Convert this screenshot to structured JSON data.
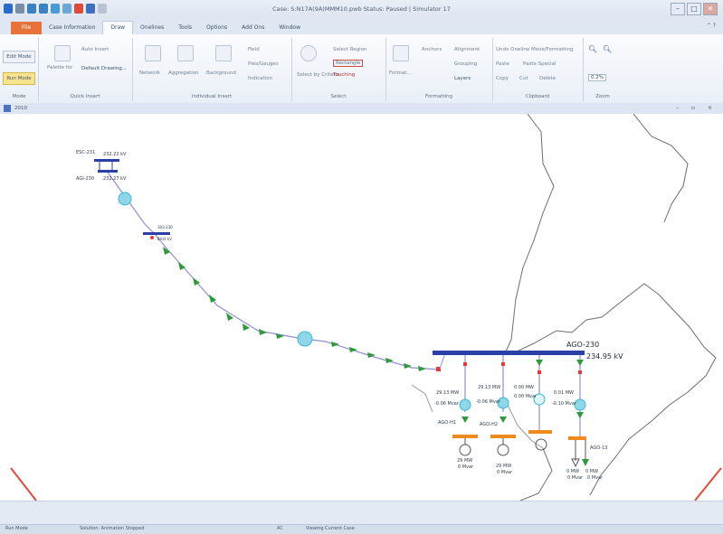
{
  "window": {
    "title": "Case: S:N17A(9A)MMM10.pwb Status: Paused | Simulator 17",
    "minimize": "–",
    "maximize": "□",
    "close": "✕"
  },
  "tabs": [
    "File",
    "Case Information",
    "Draw",
    "Onelines",
    "Tools",
    "Options",
    "Add Ons",
    "Window"
  ],
  "active_tab": "Draw",
  "help": "⌃ ?",
  "ribbon": {
    "mode": {
      "edit": "Edit Mode",
      "run": "Run Mode",
      "label": "Mode"
    },
    "quick_insert": {
      "palette": "Palette for",
      "auto_insert": "Auto Insert",
      "default_drawing": "Default Drawing...",
      "label": "Quick Insert"
    },
    "individual_insert": {
      "network": "Network",
      "aggregation": "Aggregation",
      "background": "Background",
      "field": "Field",
      "pies": "Pies/Gauges",
      "indication": "Indication",
      "label": "Individual Insert"
    },
    "select": {
      "select_by": "Select by Criteria",
      "select_region": "Select Region",
      "rectangle": "Rectangle",
      "touching": "Touching",
      "label": "Select"
    },
    "formatting": {
      "format": "Format...",
      "anchors": "Anchors",
      "alignment": "Alignment",
      "grouping": "Grouping",
      "layers": "Layers",
      "label": "Formatting"
    },
    "clipboard": {
      "undo": "Undo Oneline Move/Formatting",
      "paste": "Paste",
      "paste_special": "Paste Special",
      "copy": "Copy",
      "cut": "Cut",
      "delete": "Delete",
      "label": "Clipboard"
    },
    "zoom": {
      "value": "0.2%",
      "label": "Zoom"
    }
  },
  "document": {
    "name": "2010"
  },
  "oneline": {
    "esc_bus": {
      "name": "ESC-231",
      "value": "232.22 kV"
    },
    "agi_bus": {
      "name": "AGI-230",
      "value": "232.27 kV"
    },
    "mid_bus": {
      "name": "303-230",
      "value": "BALY kV"
    },
    "main_bus": {
      "name": "AGO-230",
      "value": "234.95 kV"
    },
    "branch_flows": [
      {
        "mw": "29.13 MW",
        "mvar": "-0.06 Mvar"
      },
      {
        "mw": "29.13 MW",
        "mvar": "-0.06 Mvar"
      },
      {
        "mw": "0.00 MW",
        "mvar": "0.00 Mvar"
      },
      {
        "mw": "0.01 MW",
        "mvar": "-0.10 Mvar"
      }
    ],
    "lower_buses": [
      "AGO-H1",
      "AGO-H2",
      "AGO-13"
    ],
    "generators": [
      {
        "mw": "29 MW",
        "mvar": "0 Mvar"
      },
      {
        "mw": "29 MW",
        "mvar": "0 Mvar"
      }
    ],
    "load": {
      "mw": "0 MW",
      "mvar": "0 Mvar",
      "mw2": "0 MW",
      "mvar2": "0 Mvar"
    }
  },
  "status": {
    "mode": "Run Mode",
    "solution": "Solution: Animation Stopped",
    "ac": "AC",
    "viewing": "Viewing Current Case"
  },
  "colors": {
    "bus": "#2a3fa8",
    "line": "#8f8fd6",
    "arrow": "#2f9a3c",
    "orange": "#ef8a1e",
    "red": "#e23b3b",
    "cyan": "#39b8d8"
  }
}
